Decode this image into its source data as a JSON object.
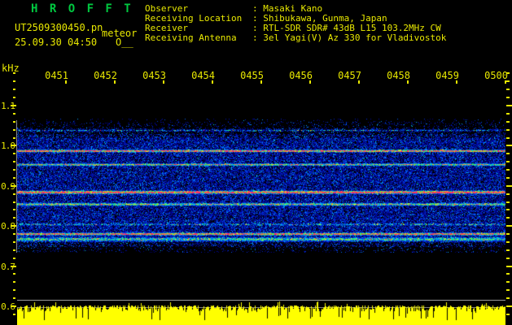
{
  "header": {
    "title": "H R O F F T",
    "filename": "UT2509300450.pn",
    "mode": "meteor",
    "datetime": "25.09.30 04:50",
    "counter": "O__",
    "colon": ":",
    "info": [
      {
        "label": "Observer",
        "value": "Masaki Kano"
      },
      {
        "label": "Receiving Location",
        "value": "Shibukawa, Gunma, Japan"
      },
      {
        "label": "Receiver",
        "value": "RTL-SDR SDR# 43dB L15 103.2MHz CW"
      },
      {
        "label": "Receiving Antenna",
        "value": "3el Yagi(V) Az 330 for Vladivostok"
      }
    ]
  },
  "colors": {
    "text_yellow": "#e8e800",
    "title_green": "#00c840",
    "graph_yellow": "#ffff00",
    "reference_grey": "#9a9a9a",
    "background": "#000000"
  },
  "chart_data": {
    "type": "heatmap",
    "title": "HROFFT radio meteor spectrogram",
    "ylabel": "kHz",
    "y_tick_labels": [
      "1.1",
      "1.0",
      "0.9",
      "0.8",
      "0.7",
      "0.6"
    ],
    "y_tick_values": [
      1.1,
      1.0,
      0.9,
      0.8,
      0.7,
      0.6
    ],
    "y_range_khz": [
      0.58,
      1.18
    ],
    "x_tick_labels": [
      "0451",
      "0452",
      "0453",
      "0454",
      "0455",
      "0456",
      "0457",
      "0458",
      "0459",
      "0500"
    ],
    "x_range_time": [
      "0450",
      "0500"
    ],
    "grid": "off",
    "legend": "none",
    "spectrogram_band_khz": [
      1.06,
      0.74
    ],
    "carrier_bands": [
      {
        "khz": 1.039,
        "strength": 0.5,
        "sigma": 0.9,
        "sparse": true,
        "appearance": "cyan dotted line"
      },
      {
        "khz": 0.988,
        "strength": 0.95,
        "sigma": 1.2,
        "sparse": false,
        "appearance": "red line, green fringe"
      },
      {
        "khz": 0.954,
        "strength": 0.7,
        "sigma": 1.1,
        "sparse": false,
        "appearance": "orange/green line"
      },
      {
        "khz": 0.885,
        "strength": 1.05,
        "sigma": 1.5,
        "sparse": false,
        "appearance": "strong red/magenta line"
      },
      {
        "khz": 0.855,
        "strength": 0.65,
        "sigma": 1.3,
        "sparse": false,
        "appearance": "green line with red speckles"
      },
      {
        "khz": 0.805,
        "strength": 0.45,
        "sigma": 1.2,
        "sparse": true,
        "appearance": "weak green line"
      },
      {
        "khz": 0.781,
        "strength": 0.9,
        "sigma": 1.3,
        "sparse": false,
        "appearance": "red/green line"
      },
      {
        "khz": 0.768,
        "strength": 0.5,
        "sigma": 2.0,
        "sparse": false,
        "appearance": "dense blue band"
      }
    ],
    "noise_level_graph": {
      "color": "#ffff00",
      "mean_level": "just below lower grey reference line",
      "reference_lines": 2
    }
  }
}
